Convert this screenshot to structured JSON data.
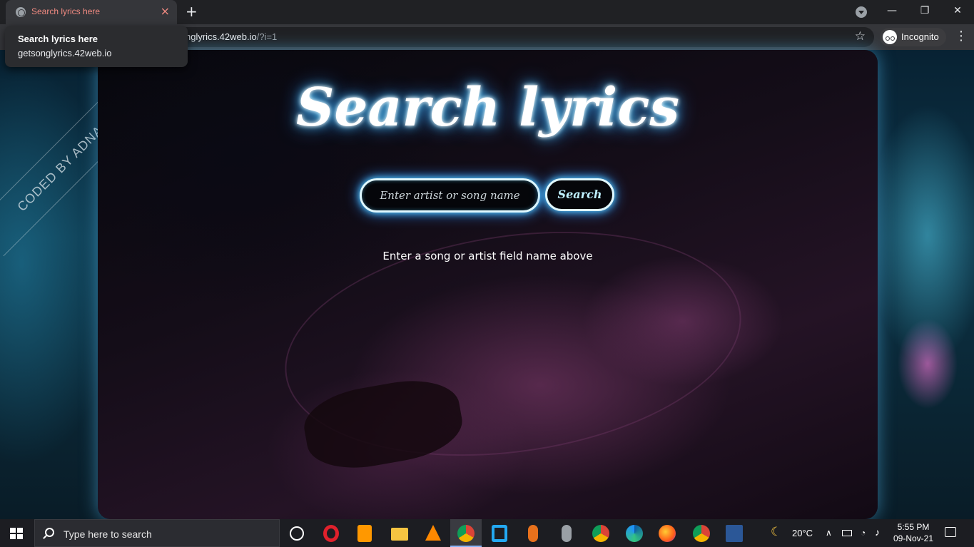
{
  "browser": {
    "tab_title": "Search lyrics here",
    "tab_close": "×",
    "new_tab": "+",
    "url_visible": "nglyrics.42web.io",
    "url_query": "/?i=1",
    "incognito_label": "Incognito",
    "window_minimize": "—",
    "window_restore": "❐",
    "window_close": "✕",
    "bookmark_star": "☆",
    "menu_dots": "⋮",
    "hovercard": {
      "title": "Search lyrics here",
      "url": "getsonglyrics.42web.io"
    }
  },
  "page": {
    "ribbon": "CODED BY ADNAN",
    "title": "Search lyrics",
    "search_placeholder": "Enter artist or song name",
    "search_button": "Search",
    "hint": "Enter a song or artist field name above"
  },
  "taskbar": {
    "search_placeholder": "Type here to search",
    "weather_temp": "20°C",
    "time": "5:55 PM",
    "date": "09-Nov-21",
    "apps": [
      "opera-icon",
      "sublime-text-icon",
      "file-explorer-icon",
      "vlc-icon",
      "chrome-icon",
      "vscode-icon",
      "podcast-mic-icon",
      "microphone-icon",
      "chrome-profile-icon",
      "edge-icon",
      "firefox-icon",
      "chrome-incognito-icon",
      "word-icon"
    ]
  },
  "colors": {
    "neon_glow": "#5ad3ff",
    "tab_title": "#f28b82",
    "chrome_dark": "#202124"
  }
}
